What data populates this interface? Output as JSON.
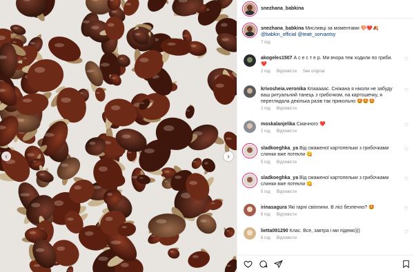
{
  "post": {
    "username": "snezhana_babkina",
    "caption": "Мисливці за моментами",
    "caption_emoji": "🍄❤️🍂",
    "mentions": "@babkin_official @teatr_sorvantsy",
    "time": "7 год"
  },
  "comments": [
    {
      "user": "akogeles1507",
      "text": "А с е с т е р. Ми вчора теж ходили по гриби.",
      "emoji": "❤️",
      "time": "2 год",
      "reply": "Відповісти",
      "extra": "See original"
    },
    {
      "user": "krivosheia.veronika",
      "text": "Клааааас. Сніжана я ніколи не забуду ваш ритуальний танець з грибочком, на картошечку, я переглядала декілька разів так прикольно",
      "emoji": "🤩🤩🤩",
      "time": "2 год",
      "reply": "Відповісти"
    },
    {
      "user": "moskalanjelika",
      "text": "Смачного",
      "emoji": "❤️",
      "time": "2 год",
      "reply": "Відповісти"
    },
    {
      "user": "sladkoeghka_ya",
      "text": "Від смаженої картопельки з грибочками слинки вже потекли",
      "emoji": "😋",
      "time": "5 год",
      "reply": "Відповісти"
    },
    {
      "user": "sladkoeghka_ya",
      "text": "Від смаженої картопельки з грибочками слинки вже потекли",
      "emoji": "😋",
      "time": "5 год",
      "reply": "Відповісти"
    },
    {
      "user": "irinasagura",
      "text": "Які гарні свіплини. В лісі безпечно?",
      "emoji": "🤩",
      "time": "6 год",
      "reply": "Відповісти"
    },
    {
      "user": "lietta091290",
      "text": "Клас. Все, завтра і ми підемо)))",
      "emoji": "",
      "time": "6 год",
      "reply": "Відповісти"
    }
  ],
  "more_icon": "more-horizontal-icon",
  "nav": {
    "prev": "‹",
    "next": "›"
  },
  "colors": {
    "story_ring": "#d62976",
    "link": "#00376b",
    "muted": "#8e8e8e"
  }
}
